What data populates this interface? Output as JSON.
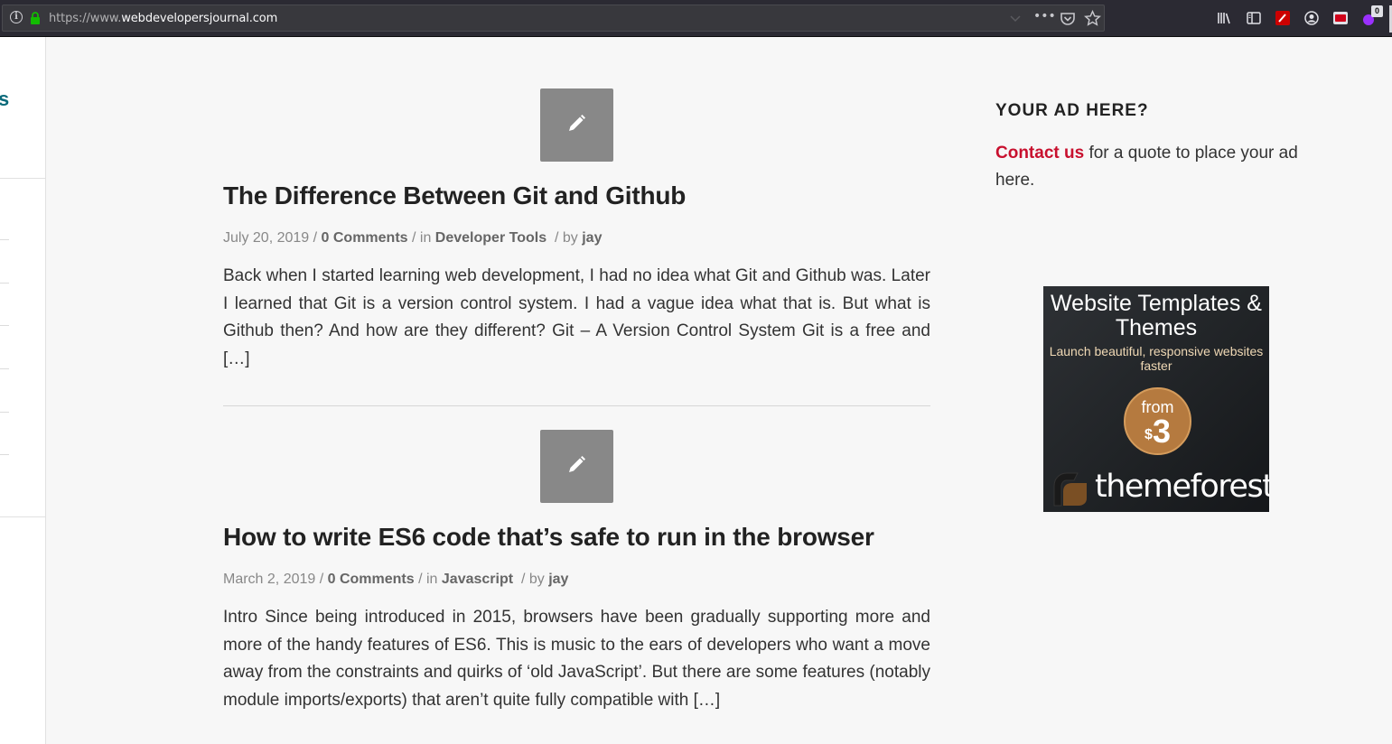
{
  "browser": {
    "url_prefix": "https://www.",
    "url_host": "webdevelopersjournal.com",
    "url_suffix": ".com",
    "more_label": "•••",
    "extension_badge": "0"
  },
  "sidebar_left": {
    "logo_fragment": "s"
  },
  "posts": [
    {
      "title": "The Difference Between Git and Github",
      "date": "July 20, 2019",
      "sep1": " / ",
      "comments": "0 Comments",
      "in_label": " / in ",
      "category": "Developer Tools",
      "by_label": " / by ",
      "author": "jay",
      "excerpt": "Back when I started learning web development, I had no idea what Git and Github was. Later I learned that Git is a version control system. I had a vague idea what that is. But what is Github then? And how are they different? Git – A Version Control System Git is a free and […]"
    },
    {
      "title": "How to write ES6 code that’s safe to run in the browser",
      "date": "March 2, 2019",
      "sep1": " / ",
      "comments": "0 Comments",
      "in_label": " / in ",
      "category": "Javascript",
      "by_label": " / by ",
      "author": "jay",
      "excerpt": "Intro Since being introduced in 2015, browsers have been gradually supporting more and more of the handy features of ES6. This is music to the ears of developers who want a move away from the constraints and quirks of ‘old JavaScript’. But there are some features (notably module imports/exports) that aren’t quite fully compatible with […]"
    }
  ],
  "ad": {
    "heading": "YOUR AD HERE?",
    "contact_link": "Contact us",
    "text": " for a quote to place your ad here."
  },
  "banner": {
    "title": "Website Templates & Themes",
    "subtitle": "Launch beautiful, responsive websites faster",
    "from_label": "from",
    "currency": "$",
    "price": "3",
    "brand": "themeforest"
  },
  "colors": {
    "accent_red": "#c8102e",
    "logo_teal": "#0a6a7a",
    "icon_gray": "#888888"
  }
}
